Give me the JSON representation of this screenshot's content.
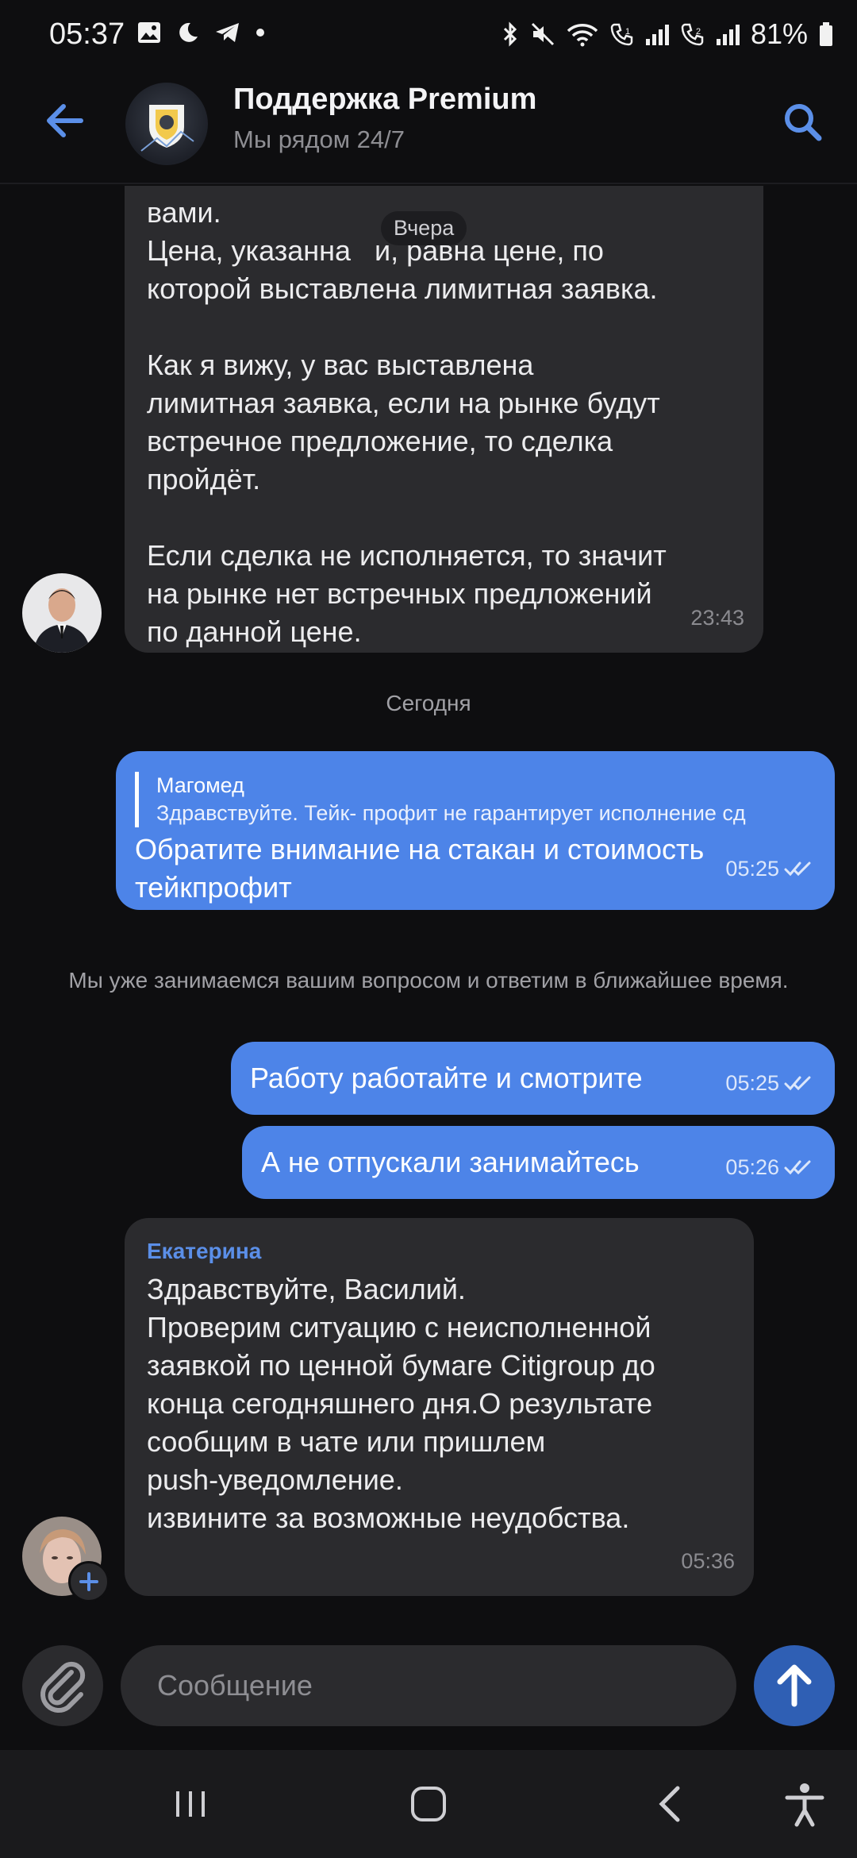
{
  "status_bar": {
    "time": "05:37",
    "battery": "81%",
    "left_icons": [
      "image-icon",
      "moon-icon",
      "telegram-icon",
      "dot-icon"
    ],
    "right_icons": [
      "bluetooth-icon",
      "mute-icon",
      "wifi-icon",
      "call1-icon",
      "signal-icon",
      "call2-icon",
      "signal-icon",
      "battery-icon"
    ]
  },
  "header": {
    "title": "Поддержка Premium",
    "subtitle": "Мы рядом 24/7"
  },
  "chat": {
    "date_pill": "Вчера",
    "messages_in_1": {
      "text_top": "вами.\nЦена, указанная в заявке, равна цене, по которой выставлена лимитная заявка.",
      "line_1": "вами.",
      "line_2a": "Цена, указанна",
      "line_2b": "и, равна цене, по",
      "line_3": "которой выставлена лимитная заявка.",
      "para_2": "Как я вижу, у вас выставлена\nлимитная заявка, если на рынке будут\nвстречное предложение, то сделка\nпройдёт.",
      "para_3": "Если сделка не исполняется, то значит\nна рынке нет встречных предложений\nпо данной цене.",
      "time": "23:43"
    },
    "today_label": "Сегодня",
    "message_out_reply": {
      "quote_name": "Магомед",
      "quote_text": "Здравствуйте. Тейк- профит не гарантирует исполнение сд",
      "text": "Обратите внимание на стакан и стоимость\nтейкпрофит",
      "time": "05:25"
    },
    "system_note": "Мы уже занимаемся вашим вопросом и ответим в ближайшее время.",
    "message_out_2": {
      "text": "Работу работайте и смотрите",
      "time": "05:25"
    },
    "message_out_3": {
      "text": "А не отпускали занимайтесь",
      "time": "05:26"
    },
    "message_in_2": {
      "sender": "Екатерина",
      "text": "Здравствуйте, Василий.\nПроверим ситуацию с неисполненной\nзаявкой по ценной бумаге Citigroup до\nконца сегодняшнего дня.О результате\nсообщим в чате или пришлем\npush-уведомление.\nизвините за возможные неудобства.",
      "time": "05:36"
    }
  },
  "input": {
    "placeholder": "Сообщение"
  },
  "colors": {
    "accent": "#4d84e8",
    "bubble_in": "#2b2b2e",
    "background": "#0e0e10",
    "sender_name": "#5b8fe8"
  }
}
